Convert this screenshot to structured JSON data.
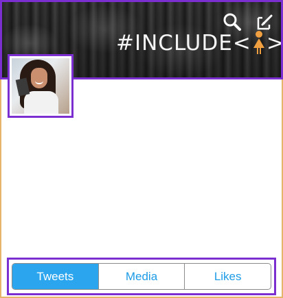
{
  "header": {
    "banner_text": "#INCLUDE<",
    "banner_text_end": ">",
    "accent_color": "#7b2fd0",
    "glyph_color": "#f0a040",
    "icons": [
      "search-icon",
      "compose-icon"
    ]
  },
  "profile": {
    "avatar": "avatar-photo"
  },
  "tabs": {
    "items": [
      {
        "label": "Tweets",
        "active": true
      },
      {
        "label": "Media",
        "active": false
      },
      {
        "label": "Likes",
        "active": false
      }
    ],
    "active_color": "#2aa5ee"
  }
}
